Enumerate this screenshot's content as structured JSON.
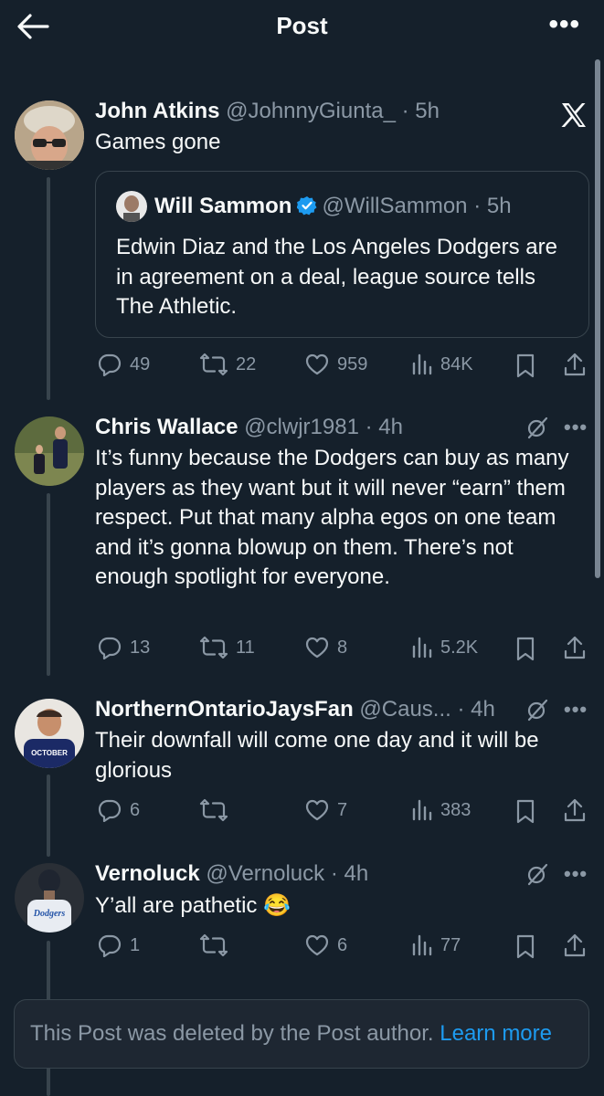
{
  "header": {
    "title": "Post"
  },
  "original": {
    "name": "John Atkins",
    "handle": "@JohnnyGiunta_",
    "time": "· 5h",
    "text": "Games gone",
    "quote": {
      "name": "Will Sammon",
      "handle": "@WillSammon",
      "time": "· 5h",
      "text": "Edwin Diaz and the Los Angeles Dodgers are in agreement on a deal, league source tells The Athletic."
    },
    "stats": {
      "replies": "49",
      "reposts": "22",
      "likes": "959",
      "views": "84K"
    }
  },
  "replies": [
    {
      "name": "Chris Wallace",
      "handle": "@clwjr1981",
      "time": "· 4h",
      "text": "It’s funny because the Dodgers can buy as many players as they want but it will never “earn” them respect. Put that many alpha egos on one team and it’s gonna blowup on them. There’s not enough spotlight for everyone.",
      "stats": {
        "replies": "13",
        "reposts": "11",
        "likes": "8",
        "views": "5.2K"
      }
    },
    {
      "name": "NorthernOntarioJaysFan",
      "handle": "@Caus...",
      "time": "· 4h",
      "text": "Their downfall will come one day and it will be glorious",
      "avatar_caption": "OCTOBER",
      "stats": {
        "replies": "6",
        "reposts": "",
        "likes": "7",
        "views": "383"
      }
    },
    {
      "name": "Vernoluck",
      "handle": "@Vernoluck",
      "time": "· 4h",
      "text": "Y’all are pathetic 😂",
      "avatar_caption": "Dodgers",
      "stats": {
        "replies": "1",
        "reposts": "",
        "likes": "6",
        "views": "77"
      }
    }
  ],
  "deleted": {
    "text": "This Post was deleted by the Post author.",
    "link": "Learn more"
  },
  "colors": {
    "background": "#15202b",
    "muted": "#8b98a5",
    "link": "#1d9bf0",
    "border": "#38444d"
  }
}
